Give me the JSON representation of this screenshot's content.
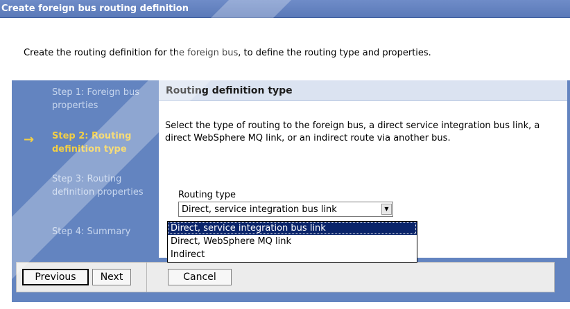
{
  "window": {
    "title": "Create foreign bus routing definition"
  },
  "intro": {
    "text": "Create the routing definition for the foreign bus, to define the routing type and properties."
  },
  "steps": [
    {
      "label": "Step 1: Foreign bus properties",
      "current": false
    },
    {
      "label": "Step 2: Routing definition type",
      "current": true
    },
    {
      "label": "Step 3: Routing definition properties",
      "current": false
    },
    {
      "label": "Step 4: Summary",
      "current": false
    }
  ],
  "current_step_icon": "right-arrow-icon",
  "section": {
    "title": "Routing definition type",
    "description": "Select the type of routing to the foreign bus, a direct service integration bus link, a direct WebSphere MQ link, or an indirect route via another bus."
  },
  "routing_type": {
    "label": "Routing type",
    "selected": "Direct, service integration bus link",
    "options": [
      "Direct, service integration bus link",
      "Direct, WebSphere MQ link",
      "Indirect"
    ]
  },
  "buttons": {
    "previous": "Previous",
    "next": "Next",
    "cancel": "Cancel"
  },
  "colors": {
    "titlebar": "#5a79b8",
    "wizard_panel": "#6384c0",
    "current_step": "#f3cf44",
    "section_header": "#dbe3f1",
    "highlight": "#0a246a"
  }
}
